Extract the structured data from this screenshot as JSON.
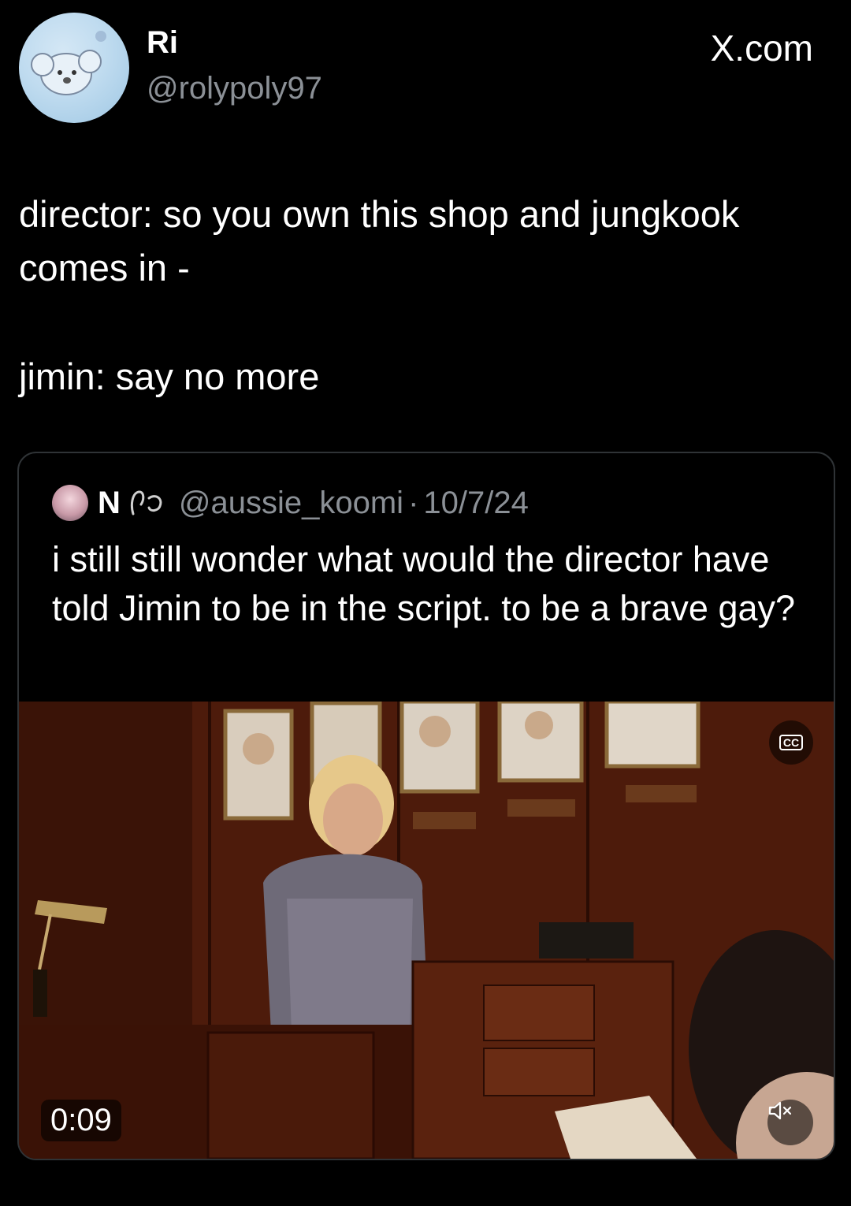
{
  "header": {
    "display_name": "Ri",
    "handle": "@rolypoly97",
    "watermark": "X.com",
    "avatar_icon": "koala-avatar-icon"
  },
  "tweet": {
    "lines": [
      "director: so you own this shop and jungkook comes in -",
      "jimin: say no more"
    ]
  },
  "quoted_tweet": {
    "name": "N",
    "handle": "@aussie_koomi",
    "separator": "·",
    "date": "10/7/24",
    "text": "i still still wonder what would the director have told Jimin to be in the script. to be a brave gay?",
    "emoji_icon": "gesture-emoji-icon"
  },
  "video": {
    "time": "0:09",
    "cc_label": "CC",
    "cc_icon": "closed-captions-icon",
    "mute_icon": "speaker-muted-icon"
  },
  "colors": {
    "background": "#000000",
    "text_primary": "#ffffff",
    "text_secondary": "#8b9096",
    "card_border": "#2f3336"
  }
}
